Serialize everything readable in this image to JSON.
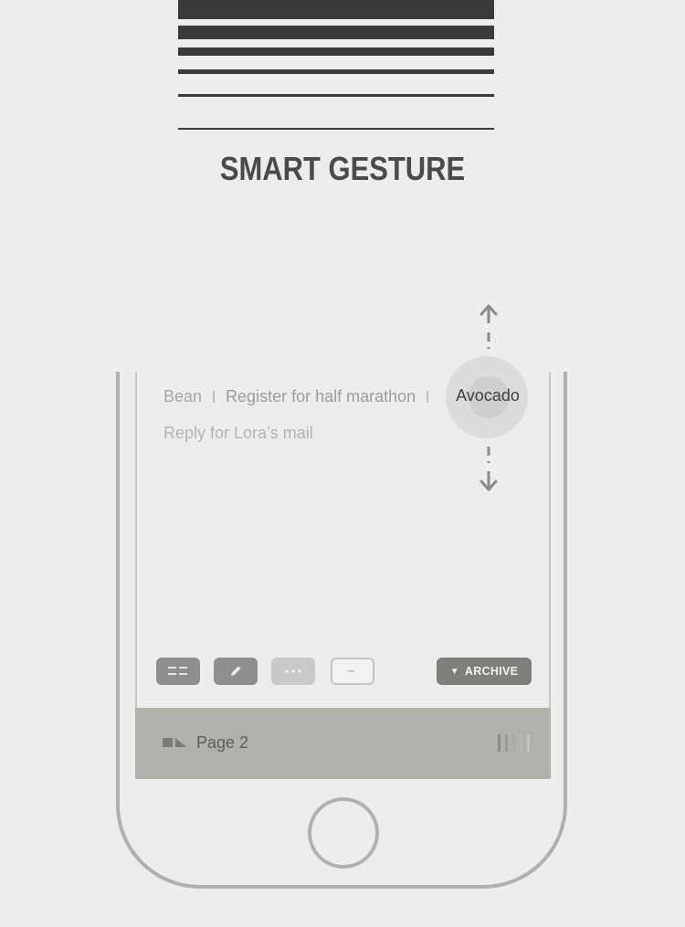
{
  "header": {
    "title": "SMART GESTURE"
  },
  "tasks": {
    "row1": [
      "Bean",
      "Register for half marathon"
    ],
    "selected": "Avocado",
    "row2": "Reply for Lora’s mail"
  },
  "toolbar": {
    "list_icon": "list-icon",
    "edit_icon": "pencil-icon",
    "more_icon": "more-dots-icon",
    "minus_icon": "minus-icon",
    "archive_label": "ARCHIVE",
    "archive_glyph": "▼"
  },
  "bottom_bar": {
    "page_icon": "flag-icon",
    "page_label": "Page 2",
    "grip_icon": "grip-lines-icon"
  },
  "colors": {
    "background": "#ededed",
    "title": "#4a4a4a",
    "stripes": "#3a3a3a",
    "button_dark": "#8f8f8f",
    "archive": "#7f7e7a",
    "bottom_bar": "#b1b0ab"
  }
}
